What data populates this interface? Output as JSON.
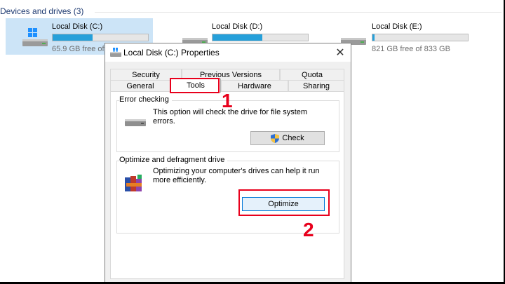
{
  "explorer": {
    "section_title": "Devices and drives (3)",
    "drives": [
      {
        "name": "Local Disk (C:)",
        "free_text": "65.9 GB free of",
        "used_fraction": 0.42,
        "selected": true
      },
      {
        "name": "Local Disk (D:)",
        "free_text": "",
        "used_fraction": 0.52,
        "selected": false
      },
      {
        "name": "Local Disk (E:)",
        "free_text": "821 GB free of 833 GB",
        "used_fraction": 0.02,
        "selected": false
      }
    ],
    "bar_color": "#26a0da"
  },
  "dialog": {
    "title": "Local Disk (C:) Properties",
    "close_glyph": "✕",
    "tabs_row1": [
      "Security",
      "Previous Versions",
      "Quota"
    ],
    "tabs_row2": [
      "General",
      "Tools",
      "Hardware",
      "Sharing"
    ],
    "active_tab": "Tools",
    "error_checking": {
      "title": "Error checking",
      "description": "This option will check the drive for file system errors.",
      "button_label": "Check"
    },
    "optimize": {
      "title": "Optimize and defragment drive",
      "description": "Optimizing your computer's drives can help it run more efficiently.",
      "button_label": "Optimize"
    }
  },
  "annotations": {
    "step1": "1",
    "step2": "2",
    "color": "#e8001c"
  }
}
